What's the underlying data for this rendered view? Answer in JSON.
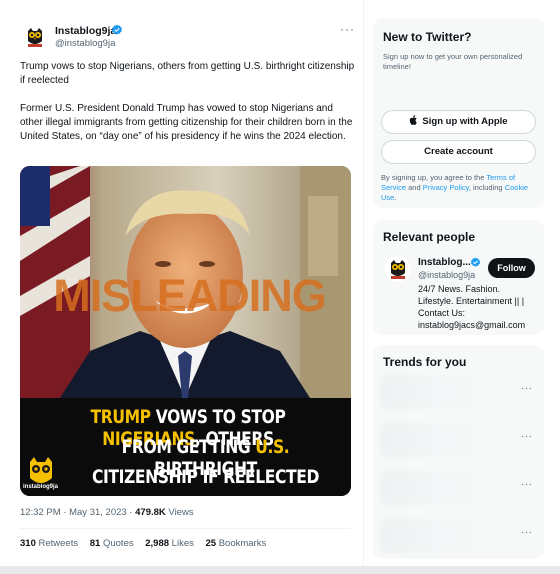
{
  "tweet": {
    "author_name": "Instablog9ja",
    "author_handle": "@instablog9ja",
    "more_label": "···",
    "text_1": "Trump vows to stop Nigerians, others from getting U.S. birthright citizenship if reelected",
    "text_2": "Former U.S. President Donald Trump has vowed to stop Nigerians and other illegal immigrants from getting citizenship for their children born in the United States, on “day one” of his presidency if he wins the 2024 election.",
    "media": {
      "stamp": "MISLEADING",
      "caption": {
        "line1_a": "TRUMP",
        "line1_b": " VOWS TO STOP ",
        "line1_c": "NIGERIANS",
        "line1_d": ", OTHERS",
        "line2_a": "FROM GETTING ",
        "line2_b": "U.S.",
        "line2_c": " BIRTHRIGHT",
        "line3": "CITIZENSHIP IF REELECTED"
      },
      "logo_text": "instablog9ja"
    },
    "timestamp": "12:32 PM · May 31, 2023 · ",
    "views_value": "479.8K",
    "views_label": " Views",
    "stats": {
      "retweets_value": "310",
      "retweets_label": " Retweets",
      "quotes_value": "81",
      "quotes_label": " Quotes",
      "likes_value": "2,988",
      "likes_label": " Likes",
      "bookmarks_value": "25",
      "bookmarks_label": " Bookmarks"
    }
  },
  "sidebar": {
    "new_to_twitter": {
      "title": "New to Twitter?",
      "subtitle": "Sign up now to get your own personalized timeline!",
      "apple_button": "Sign up with Apple",
      "create_button": "Create account",
      "terms_prefix": "By signing up, you agree to the ",
      "terms_link": "Terms of Service",
      "terms_and": " and ",
      "privacy_link": "Privacy Policy",
      "terms_including": ", including ",
      "cookie_link": "Cookie Use",
      "terms_end": "."
    },
    "relevant_people": {
      "title": "Relevant people",
      "name": "Instablog...",
      "handle": "@instablog9ja",
      "follow_label": "Follow",
      "bio": "24/7 News. Fashion. Lifestyle. Entertainment || | Contact Us: instablog9jacs@gmail.com"
    },
    "trends": {
      "title": "Trends for you",
      "more_label": "···"
    }
  },
  "colors": {
    "accent_blue": "#1d9bf0",
    "text_primary": "#0f1419",
    "text_secondary": "#536471",
    "caption_highlight": "#f5c000",
    "stamp_orange": "#d66e1e"
  },
  "icons": [
    "verified-badge-icon",
    "more-dots-icon",
    "apple-icon",
    "owl-logo-icon"
  ]
}
